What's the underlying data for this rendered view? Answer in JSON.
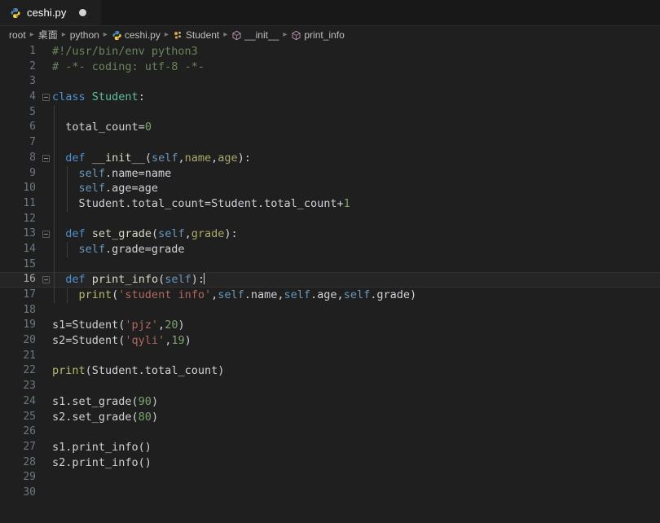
{
  "window": {
    "background_color": "#1f1f1f",
    "tabbar_color": "#181818"
  },
  "tabbar": {
    "tabs": [
      {
        "label": "ceshi.py",
        "icon": "python-file-icon",
        "dirty": true,
        "active": true
      }
    ]
  },
  "breadcrumb": {
    "items": [
      {
        "label": "root",
        "icon": null
      },
      {
        "label": "桌面",
        "icon": null
      },
      {
        "label": "python",
        "icon": null
      },
      {
        "label": "ceshi.py",
        "icon": "python-file-icon"
      },
      {
        "label": "Student",
        "icon": "class-icon"
      },
      {
        "label": "__init__",
        "icon": "method-icon"
      },
      {
        "label": "print_info",
        "icon": "method-icon"
      }
    ],
    "separator": "▸"
  },
  "editor": {
    "language": "python",
    "current_line": 16,
    "cursor_column": 21,
    "total_lines": 30,
    "lines": [
      {
        "n": 1,
        "fold": false,
        "indent": 0,
        "tokens": [
          {
            "t": "comment",
            "v": "#!/usr/bin/env python3"
          }
        ]
      },
      {
        "n": 2,
        "fold": false,
        "indent": 0,
        "tokens": [
          {
            "t": "comment",
            "v": "# -*- coding: utf-8 -*-"
          }
        ]
      },
      {
        "n": 3,
        "fold": false,
        "indent": 0,
        "tokens": []
      },
      {
        "n": 4,
        "fold": true,
        "indent": 0,
        "tokens": [
          {
            "t": "kw",
            "v": "class"
          },
          {
            "t": "plain",
            "v": " "
          },
          {
            "t": "cls",
            "v": "Student"
          },
          {
            "t": "punct",
            "v": ":"
          }
        ]
      },
      {
        "n": 5,
        "fold": false,
        "indent": 1,
        "tokens": []
      },
      {
        "n": 6,
        "fold": false,
        "indent": 1,
        "tokens": [
          {
            "t": "plain",
            "v": "  total_count"
          },
          {
            "t": "punct",
            "v": "="
          },
          {
            "t": "num",
            "v": "0"
          }
        ]
      },
      {
        "n": 7,
        "fold": false,
        "indent": 1,
        "tokens": []
      },
      {
        "n": 8,
        "fold": true,
        "indent": 1,
        "tokens": [
          {
            "t": "plain",
            "v": "  "
          },
          {
            "t": "kw",
            "v": "def"
          },
          {
            "t": "plain",
            "v": " "
          },
          {
            "t": "fn",
            "v": "__init__"
          },
          {
            "t": "punct",
            "v": "("
          },
          {
            "t": "self",
            "v": "self"
          },
          {
            "t": "punct",
            "v": ","
          },
          {
            "t": "param",
            "v": "name"
          },
          {
            "t": "punct",
            "v": ","
          },
          {
            "t": "param",
            "v": "age"
          },
          {
            "t": "punct",
            "v": "):"
          }
        ]
      },
      {
        "n": 9,
        "fold": false,
        "indent": 2,
        "tokens": [
          {
            "t": "plain",
            "v": "    "
          },
          {
            "t": "self",
            "v": "self"
          },
          {
            "t": "plain",
            "v": ".name=name"
          }
        ]
      },
      {
        "n": 10,
        "fold": false,
        "indent": 2,
        "tokens": [
          {
            "t": "plain",
            "v": "    "
          },
          {
            "t": "self",
            "v": "self"
          },
          {
            "t": "plain",
            "v": ".age=age"
          }
        ]
      },
      {
        "n": 11,
        "fold": false,
        "indent": 2,
        "tokens": [
          {
            "t": "plain",
            "v": "    Student.total_count=Student.total_count+"
          },
          {
            "t": "num",
            "v": "1"
          }
        ]
      },
      {
        "n": 12,
        "fold": false,
        "indent": 1,
        "tokens": []
      },
      {
        "n": 13,
        "fold": true,
        "indent": 1,
        "tokens": [
          {
            "t": "plain",
            "v": "  "
          },
          {
            "t": "kw",
            "v": "def"
          },
          {
            "t": "plain",
            "v": " "
          },
          {
            "t": "fn",
            "v": "set_grade"
          },
          {
            "t": "punct",
            "v": "("
          },
          {
            "t": "self",
            "v": "self"
          },
          {
            "t": "punct",
            "v": ","
          },
          {
            "t": "param",
            "v": "grade"
          },
          {
            "t": "punct",
            "v": "):"
          }
        ]
      },
      {
        "n": 14,
        "fold": false,
        "indent": 2,
        "tokens": [
          {
            "t": "plain",
            "v": "    "
          },
          {
            "t": "self",
            "v": "self"
          },
          {
            "t": "plain",
            "v": ".grade=grade"
          }
        ]
      },
      {
        "n": 15,
        "fold": false,
        "indent": 1,
        "tokens": []
      },
      {
        "n": 16,
        "fold": true,
        "indent": 1,
        "tokens": [
          {
            "t": "plain",
            "v": "  "
          },
          {
            "t": "kw",
            "v": "def"
          },
          {
            "t": "plain",
            "v": " "
          },
          {
            "t": "fn",
            "v": "print_info"
          },
          {
            "t": "punct",
            "v": "("
          },
          {
            "t": "self",
            "v": "self"
          },
          {
            "t": "punct",
            "v": "):"
          }
        ]
      },
      {
        "n": 17,
        "fold": false,
        "indent": 2,
        "tokens": [
          {
            "t": "plain",
            "v": "    "
          },
          {
            "t": "builtin",
            "v": "print"
          },
          {
            "t": "punct",
            "v": "("
          },
          {
            "t": "str",
            "v": "'student info'"
          },
          {
            "t": "punct",
            "v": ","
          },
          {
            "t": "self",
            "v": "self"
          },
          {
            "t": "plain",
            "v": ".name,"
          },
          {
            "t": "self",
            "v": "self"
          },
          {
            "t": "plain",
            "v": ".age,"
          },
          {
            "t": "self",
            "v": "self"
          },
          {
            "t": "plain",
            "v": ".grade)"
          }
        ]
      },
      {
        "n": 18,
        "fold": false,
        "indent": 0,
        "tokens": []
      },
      {
        "n": 19,
        "fold": false,
        "indent": 0,
        "tokens": [
          {
            "t": "plain",
            "v": "s1=Student("
          },
          {
            "t": "str",
            "v": "'pjz'"
          },
          {
            "t": "punct",
            "v": ","
          },
          {
            "t": "num",
            "v": "20"
          },
          {
            "t": "punct",
            "v": ")"
          }
        ]
      },
      {
        "n": 20,
        "fold": false,
        "indent": 0,
        "tokens": [
          {
            "t": "plain",
            "v": "s2=Student("
          },
          {
            "t": "str",
            "v": "'qyli'"
          },
          {
            "t": "punct",
            "v": ","
          },
          {
            "t": "num",
            "v": "19"
          },
          {
            "t": "punct",
            "v": ")"
          }
        ]
      },
      {
        "n": 21,
        "fold": false,
        "indent": 0,
        "tokens": []
      },
      {
        "n": 22,
        "fold": false,
        "indent": 0,
        "tokens": [
          {
            "t": "builtin",
            "v": "print"
          },
          {
            "t": "punct",
            "v": "("
          },
          {
            "t": "plain",
            "v": "Student.total_count"
          },
          {
            "t": "punct",
            "v": ")"
          }
        ]
      },
      {
        "n": 23,
        "fold": false,
        "indent": 0,
        "tokens": []
      },
      {
        "n": 24,
        "fold": false,
        "indent": 0,
        "tokens": [
          {
            "t": "plain",
            "v": "s1.set_grade("
          },
          {
            "t": "num",
            "v": "90"
          },
          {
            "t": "punct",
            "v": ")"
          }
        ]
      },
      {
        "n": 25,
        "fold": false,
        "indent": 0,
        "tokens": [
          {
            "t": "plain",
            "v": "s2.set_grade("
          },
          {
            "t": "num",
            "v": "80"
          },
          {
            "t": "punct",
            "v": ")"
          }
        ]
      },
      {
        "n": 26,
        "fold": false,
        "indent": 0,
        "tokens": []
      },
      {
        "n": 27,
        "fold": false,
        "indent": 0,
        "tokens": [
          {
            "t": "plain",
            "v": "s1.print_info()"
          }
        ]
      },
      {
        "n": 28,
        "fold": false,
        "indent": 0,
        "tokens": [
          {
            "t": "plain",
            "v": "s2.print_info()"
          }
        ]
      },
      {
        "n": 29,
        "fold": false,
        "indent": 0,
        "tokens": []
      },
      {
        "n": 30,
        "fold": false,
        "indent": 0,
        "tokens": []
      }
    ]
  },
  "theme": {
    "comment": "#6a8759",
    "keyword": "#4d90d0",
    "class_name": "#5ebf9a",
    "function": "#d6d6c2",
    "self": "#6897bb",
    "parameter": "#a9a96b",
    "string": "#b0685f",
    "number": "#7ca46c",
    "plain": "#cfd2d6",
    "builtin": "#b6bb6a",
    "line_number": "#6e7681",
    "current_line_bg": "#252526"
  }
}
